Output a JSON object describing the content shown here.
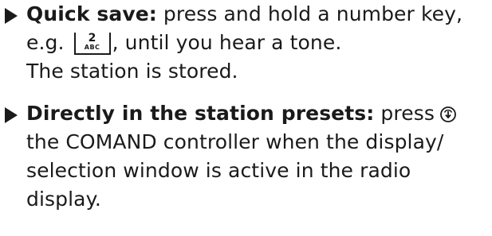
{
  "items": [
    {
      "lead": "Quick save:",
      "line1_rest": " press and hold a number key,",
      "line2_before": "e.g. ",
      "key": {
        "number": "2",
        "letters": "ABC"
      },
      "line2_after": ", until you hear a tone.",
      "line3": "The station is stored."
    },
    {
      "lead": "Directly in the station presets:",
      "line1_rest": " press",
      "icon": "controller-press-icon",
      "line2": "the COMAND controller when the display/",
      "line3": "selection window is active in the radio",
      "line4": "display."
    }
  ]
}
